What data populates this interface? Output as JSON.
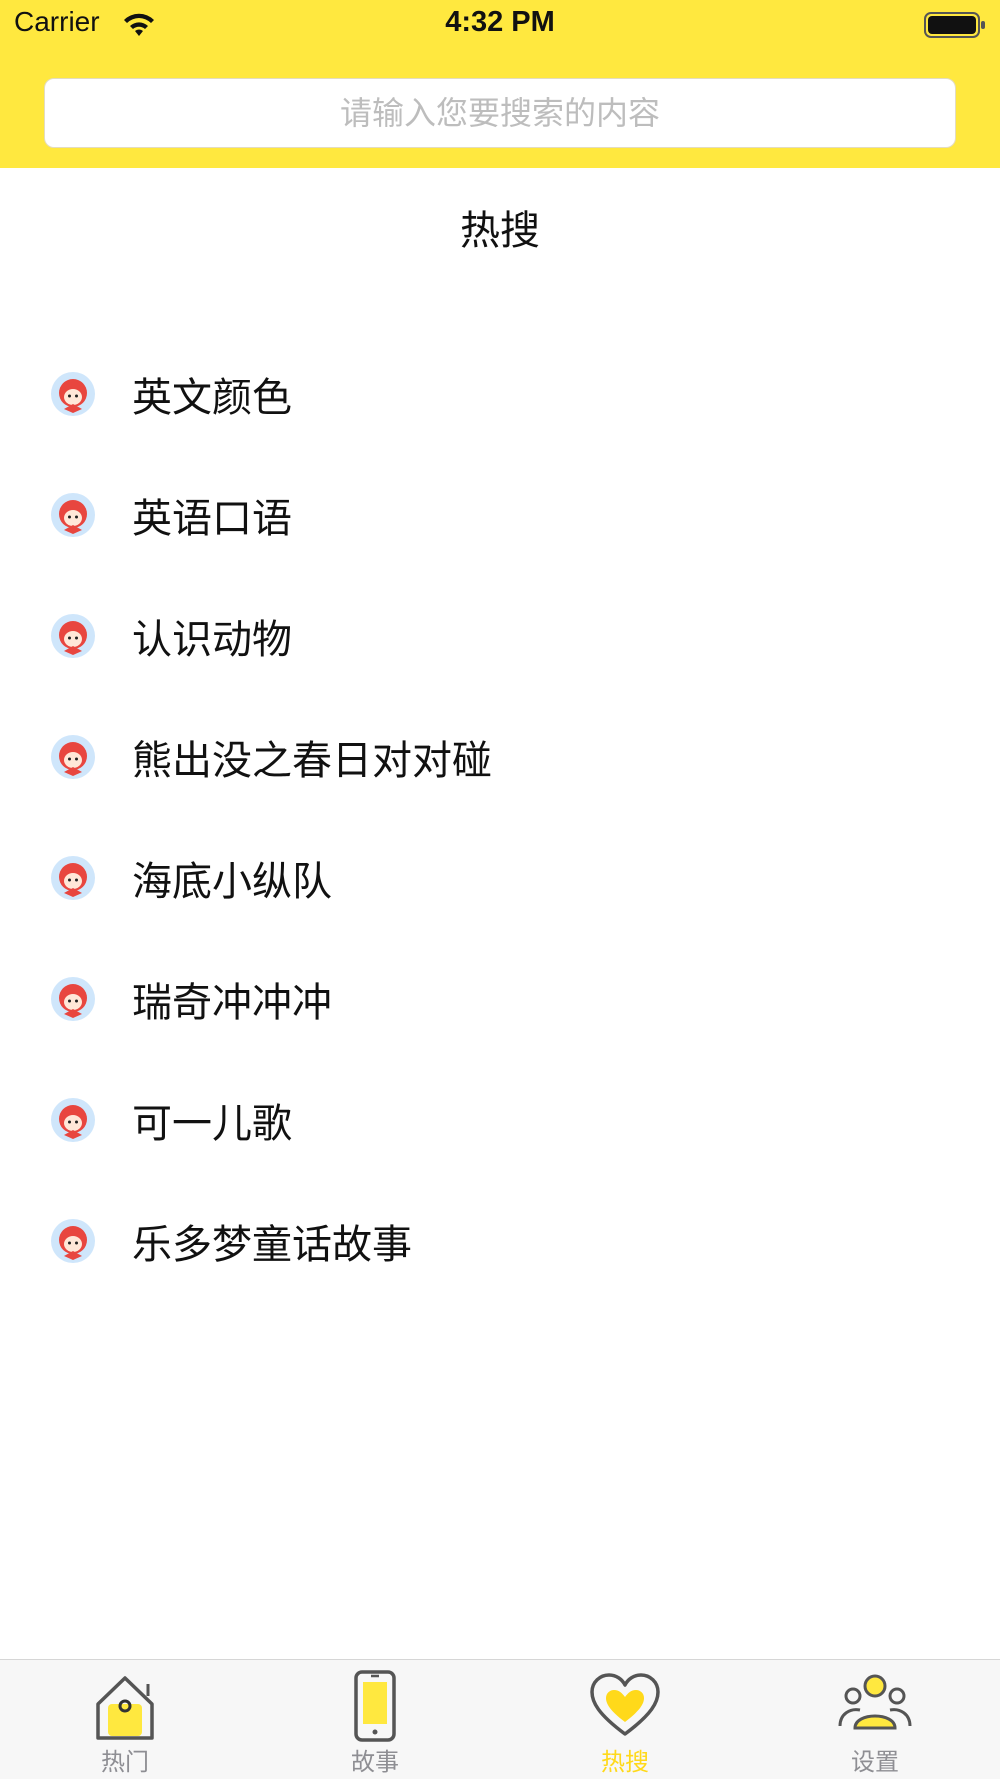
{
  "status_bar": {
    "carrier": "Carrier",
    "time": "4:32 PM",
    "icons": [
      "wifi-icon",
      "battery-icon"
    ]
  },
  "search": {
    "placeholder": "请输入您要搜索的内容",
    "value": ""
  },
  "page": {
    "title": "热搜"
  },
  "hot_list": {
    "item_icon": "character-avatar-icon",
    "items": [
      {
        "label": "英文颜色"
      },
      {
        "label": "英语口语"
      },
      {
        "label": "认识动物"
      },
      {
        "label": "熊出没之春日对对碰"
      },
      {
        "label": "海底小纵队"
      },
      {
        "label": "瑞奇冲冲冲"
      },
      {
        "label": "可一儿歌"
      },
      {
        "label": "乐多梦童话故事"
      }
    ]
  },
  "tab_bar": {
    "tabs": [
      {
        "label": "热门",
        "icon": "house-icon",
        "active": false
      },
      {
        "label": "故事",
        "icon": "phone-icon",
        "active": false
      },
      {
        "label": "热搜",
        "icon": "heart-icon",
        "active": true
      },
      {
        "label": "设置",
        "icon": "people-icon",
        "active": false
      }
    ]
  },
  "colors": {
    "brand_yellow": "#ffe83f",
    "active_tab": "#ffd91a",
    "inactive_tab": "#8e8e93"
  }
}
